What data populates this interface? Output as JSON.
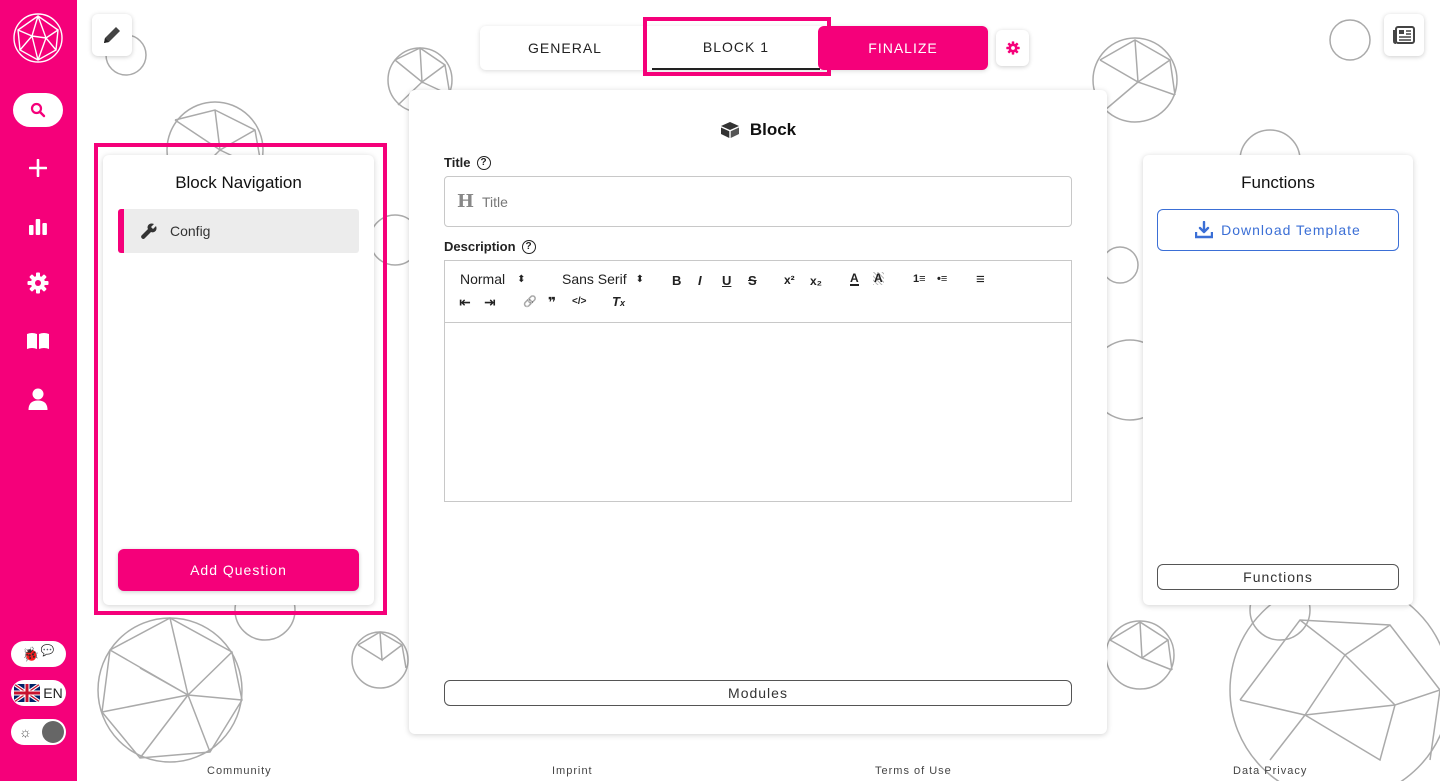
{
  "colors": {
    "accent": "#f5007a",
    "link": "#3b6fd6"
  },
  "top_tabs": [
    {
      "label": "GENERAL"
    },
    {
      "label": "BLOCK 1"
    },
    {
      "label": "FINALIZE"
    }
  ],
  "sidebar": {
    "icons": [
      "search-icon",
      "plus-icon",
      "chart-icon",
      "gear-icon",
      "book-icon",
      "user-icon"
    ],
    "language": "EN"
  },
  "block_nav": {
    "title": "Block Navigation",
    "items": [
      {
        "label": "Config",
        "icon": "wrench-icon"
      }
    ],
    "add_button": "Add Question"
  },
  "block_editor": {
    "heading": "Block",
    "title_label": "Title",
    "title_icon_glyph": "H",
    "title_placeholder": "Title",
    "description_label": "Description",
    "help_glyph": "?",
    "toolbar": {
      "format": "Normal",
      "font": "Sans Serif",
      "bold": "B",
      "italic": "I",
      "underline": "U",
      "strike": "S",
      "superscript": "x²",
      "subscript": "x₂",
      "text_color": "A",
      "background_color": "A",
      "ordered_list": "1≡",
      "bullet_list": "•≡",
      "align": "≡",
      "outdent": "⇤",
      "indent": "⇥",
      "link": "🔗",
      "blockquote": "❞",
      "code": "</>",
      "clear_format": "T"
    },
    "modules_button": "Modules"
  },
  "functions": {
    "title": "Functions",
    "download_button": "Download Template",
    "footer_button": "Functions"
  },
  "footer": {
    "links": [
      "Community",
      "Imprint",
      "Terms of Use",
      "Data Privacy"
    ]
  }
}
